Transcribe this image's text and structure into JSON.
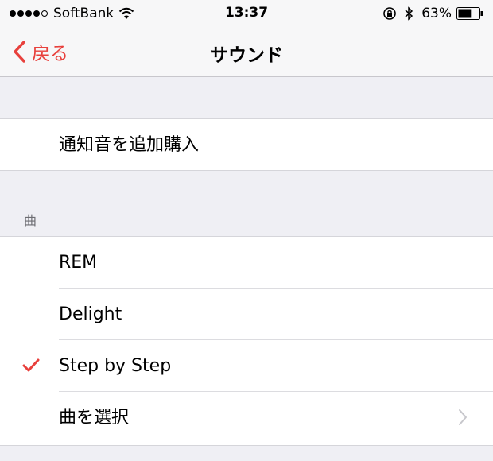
{
  "status_bar": {
    "carrier": "SoftBank",
    "time": "13:37",
    "battery_percent": "63%",
    "signal_bars_filled": 4,
    "signal_bars_total": 5,
    "battery_level": 0.63
  },
  "nav": {
    "back_label": "戻る",
    "title": "サウンド"
  },
  "purchase": {
    "label": "通知音を追加購入"
  },
  "songs": {
    "header": "曲",
    "items": [
      {
        "label": "REM",
        "checked": false
      },
      {
        "label": "Delight",
        "checked": false
      },
      {
        "label": "Step by Step",
        "checked": true
      }
    ],
    "choose_label": "曲を選択"
  },
  "colors": {
    "accent": "#e8403c",
    "background": "#efeff4",
    "secondary_text": "#6d6d72"
  },
  "icons": [
    "wifi-icon",
    "rotation-lock-icon",
    "bluetooth-icon",
    "battery-icon",
    "back-chevron-icon",
    "checkmark-icon",
    "disclosure-chevron-icon"
  ]
}
